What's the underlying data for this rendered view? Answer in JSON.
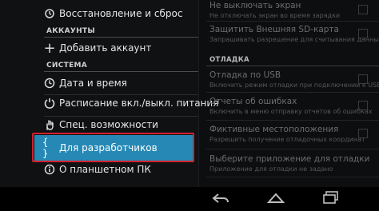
{
  "left_menu": {
    "restore_reset": "Восстановление и сброс",
    "accounts_header": "АККАУНТЫ",
    "add_account": "Добавить аккаунт",
    "system_header": "СИСТЕМА",
    "date_time": "Дата и время",
    "power_schedule": "Расписание вкл./выкл. питания",
    "accessibility": "Спец. возможности",
    "developer_options": "Для разработчиков",
    "about_tablet": "О планшетном ПК"
  },
  "right_pane": {
    "stay_awake_title": "Не выключать экран",
    "stay_awake_sub": "Не отключать экран во время зарядки",
    "protect_sd_title": "Защитить Внешняя SD-карта",
    "protect_sd_sub": "Запрашивать разрешение для считывания данных",
    "debug_header": "ОТЛАДКА",
    "usb_debug_title": "Отладка по USB",
    "usb_debug_sub": "Включить режим отладки при подключении к USB",
    "bug_reports_title": "Отчеты об ошибках",
    "bug_reports_sub": "Включить в меню отправку отчетов об ошибках",
    "mock_location_title": "Фиктивные местоположения",
    "mock_location_sub": "Разрешить получение отладочных координат",
    "debug_app_title": "Выберите приложение для отладки",
    "debug_app_sub": "Приложение для отладки не задано"
  },
  "navbar": {
    "back_icon": "back-arrow",
    "home_icon": "home",
    "recents_icon": "recent-apps"
  },
  "colors": {
    "selected_bg": "#2689b5",
    "highlight_border": "#d3222a"
  }
}
